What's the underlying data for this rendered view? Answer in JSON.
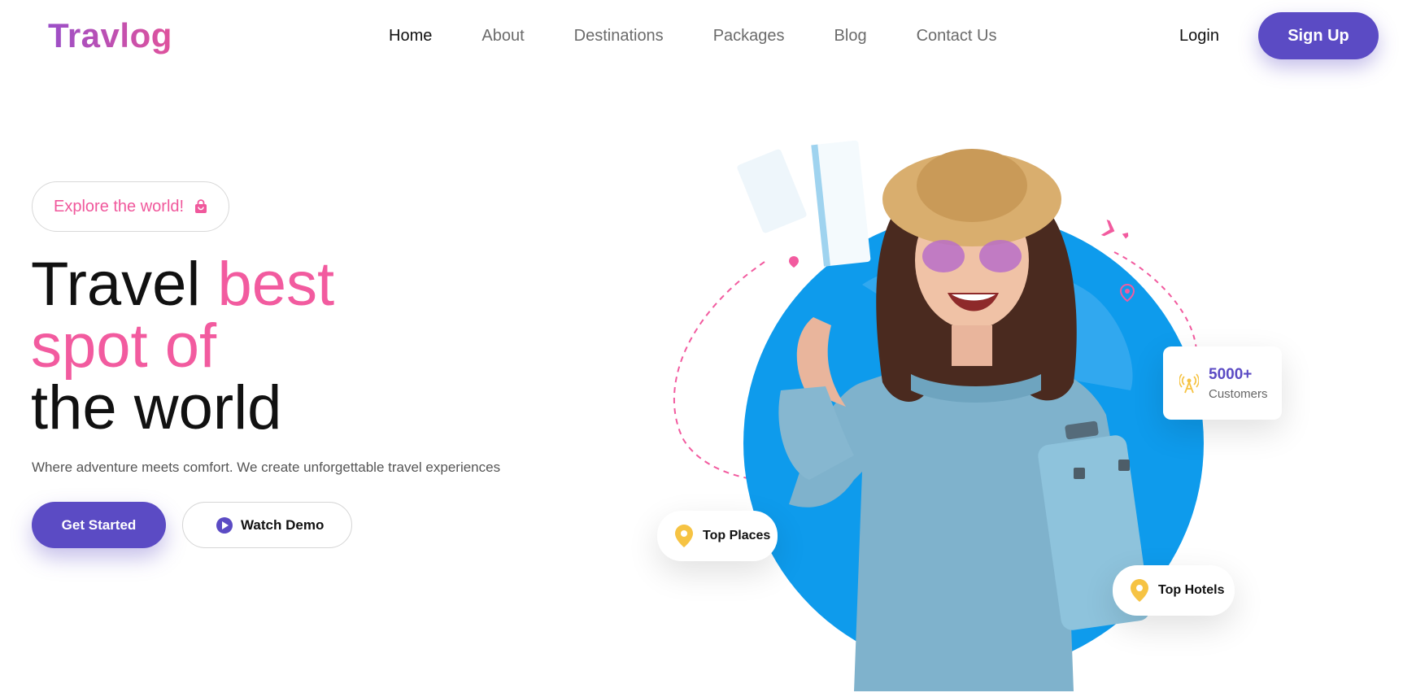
{
  "brand": {
    "name": "Travlog"
  },
  "nav": {
    "items": [
      {
        "label": "Home",
        "active": true
      },
      {
        "label": "About",
        "active": false
      },
      {
        "label": "Destinations",
        "active": false
      },
      {
        "label": "Packages",
        "active": false
      },
      {
        "label": "Blog",
        "active": false
      },
      {
        "label": "Contact Us",
        "active": false
      }
    ],
    "login": "Login",
    "signup": "Sign Up"
  },
  "hero": {
    "pill": "Explore the world!",
    "headline_1": "Travel ",
    "headline_1_pink": "best",
    "headline_2_pink": "spot of",
    "headline_3": "the world",
    "subtitle": "Where adventure meets comfort. We create unforgettable travel experiences",
    "cta_primary": "Get Started",
    "cta_secondary": "Watch Demo"
  },
  "badges": {
    "top_places": "Top Places",
    "top_hotels": "Top Hotels",
    "customers_count": "5000+",
    "customers_label": "Customers"
  },
  "colors": {
    "primary": "#5b4bc4",
    "pink": "#f25b9f",
    "circle": "#0e9bec",
    "pin": "#f6c343"
  }
}
